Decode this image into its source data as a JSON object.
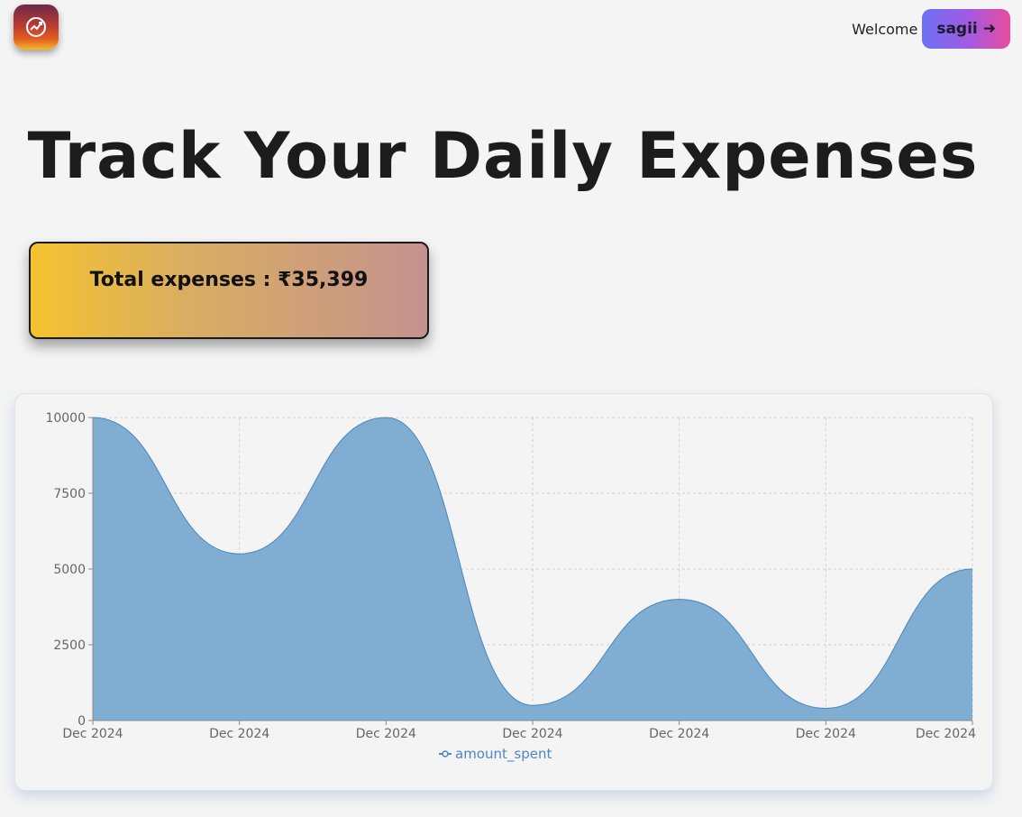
{
  "header": {
    "logo_icon": "expense-tracker-logo-icon",
    "welcome_text": "Welcome",
    "user_name": "sagii",
    "user_arrow": "➜"
  },
  "main": {
    "title": "Track Your Daily Expenses",
    "total_expenses_text": "Total expenses : ₹35,399"
  },
  "colors": {
    "area_fill": "#7faed2",
    "area_stroke": "#4a86bd",
    "grid": "#cfcfcf",
    "legend": "#4e88c3"
  },
  "chart_data": {
    "type": "area",
    "x": [
      "Dec 2024",
      "Dec 2024",
      "Dec 2024",
      "Dec 2024",
      "Dec 2024",
      "Dec 2024",
      "Dec 2024"
    ],
    "series": [
      {
        "name": "amount_spent",
        "values": [
          10000,
          5500,
          10000,
          500,
          4000,
          400,
          5000
        ]
      }
    ],
    "yticks": [
      0,
      2500,
      5000,
      7500,
      10000
    ],
    "ylim": [
      0,
      10000
    ],
    "grid": true,
    "legend": "bottom",
    "curve": "smooth"
  }
}
